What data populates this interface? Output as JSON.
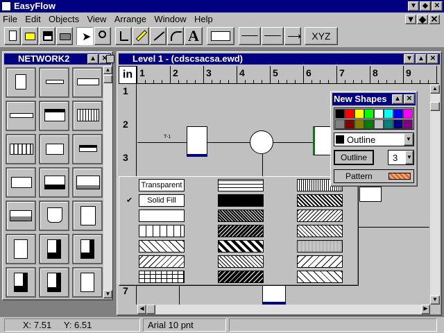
{
  "app": {
    "title": "EasyFlow"
  },
  "menu": [
    "File",
    "Edit",
    "Objects",
    "View",
    "Arrange",
    "Window",
    "Help"
  ],
  "toolbar": {
    "xyz": "XYZ",
    "text_tool": "A"
  },
  "network_window": {
    "title": "NETWORK2"
  },
  "level_window": {
    "title": "Level 1 - (cdscsacsa.ewd)",
    "ruler_unit": "in",
    "h_ticks": [
      "1",
      "2",
      "3",
      "4",
      "5",
      "6",
      "7",
      "8",
      "9"
    ],
    "v_ticks": [
      "1",
      "2",
      "3",
      "7"
    ]
  },
  "canvas": {
    "connector_label": "T-1"
  },
  "new_shapes": {
    "title": "New Shapes",
    "outline_select": "Outline",
    "outline_button": "Outline",
    "width_value": "3",
    "pattern_label": "Pattern"
  },
  "fill_menu": {
    "transparent": "Transparent",
    "solid": "Solid Fill",
    "checkmark": "✔"
  },
  "status": {
    "x": "X: 7.51",
    "y": "Y: 6.51",
    "font": "Arial  10 pnt"
  },
  "colors": [
    "#000000",
    "#808080",
    "#ff0000",
    "#800000",
    "#ffff00",
    "#808000",
    "#00ff00",
    "#008000",
    "#ffffff",
    "#c0c0c0",
    "#00ffff",
    "#008080",
    "#0000ff",
    "#000080",
    "#ff00ff",
    "#800080"
  ]
}
